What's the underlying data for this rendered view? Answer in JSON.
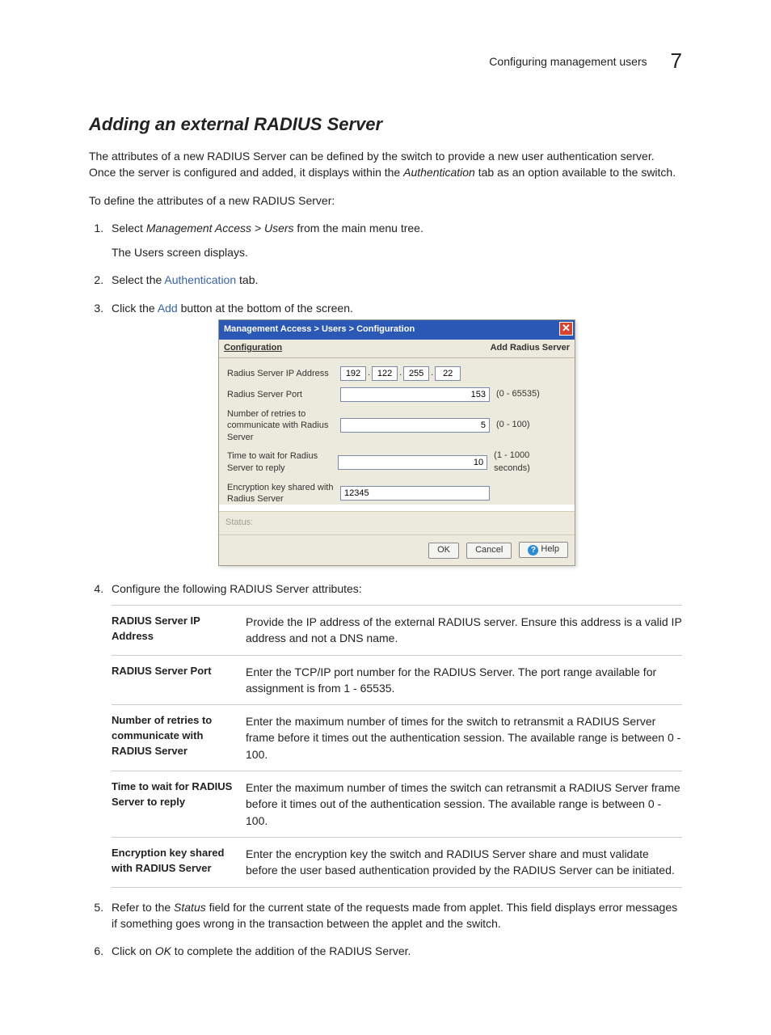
{
  "header": {
    "running_title": "Configuring management users",
    "chapter_number": "7"
  },
  "section_title": "Adding an external RADIUS Server",
  "intro_p1_a": "The attributes of a new RADIUS Server can be defined by the switch to provide a new user authentication server. Once the server is configured and added, it displays within the ",
  "intro_p1_i": "Authentication",
  "intro_p1_b": " tab as an option available to the switch.",
  "intro_p2": "To define the attributes of a new RADIUS Server:",
  "steps": {
    "s1_a": "Select ",
    "s1_i": "Management Access > Users",
    "s1_b": " from the main menu tree.",
    "s1_sub": "The Users screen displays.",
    "s2_a": "Select the ",
    "s2_link": "Authentication",
    "s2_b": " tab.",
    "s3_a": "Click the ",
    "s3_link": "Add",
    "s3_b": " button at the bottom of the screen.",
    "s4": "Configure the following RADIUS Server attributes:",
    "s5_a": "Refer to the ",
    "s5_i": "Status",
    "s5_b": " field for the current state of the requests made from applet. This field displays error messages if something goes wrong in the transaction between the applet and the switch.",
    "s6_a": "Click on ",
    "s6_i": "OK",
    "s6_b": " to complete the addition of the RADIUS Server."
  },
  "dialog": {
    "title": "Management Access > Users > Configuration",
    "close_glyph": "✕",
    "sub_left": "Configuration",
    "sub_right": "Add Radius Server",
    "rows": {
      "ip_label": "Radius Server IP Address",
      "ip": {
        "o1": "192",
        "o2": "122",
        "o3": "255",
        "o4": "22",
        "dot": "."
      },
      "port_label": "Radius Server Port",
      "port_value": "153",
      "port_hint": "(0 - 65535)",
      "retries_label": "Number of retries to communicate with Radius Server",
      "retries_value": "5",
      "retries_hint": "(0 - 100)",
      "wait_label": "Time to wait for Radius Server to reply",
      "wait_value": "10",
      "wait_hint": "(1 - 1000 seconds)",
      "key_label": "Encryption key shared with Radius Server",
      "key_value": "12345"
    },
    "status_label": "Status:",
    "buttons": {
      "ok": "OK",
      "cancel": "Cancel",
      "help": "Help",
      "help_glyph": "?"
    }
  },
  "attributes": [
    {
      "name": "RADIUS Server IP Address",
      "desc": "Provide the IP address of the external RADIUS server. Ensure this address is a valid IP address and not a DNS name."
    },
    {
      "name": "RADIUS Server Port",
      "desc": "Enter the TCP/IP port number for the RADIUS Server. The port range available for assignment is from 1 - 65535."
    },
    {
      "name": "Number of retries to communicate with RADIUS Server",
      "desc": "Enter the maximum number of times for the switch to retransmit a RADIUS Server frame before it times out the authentication session. The available range is between 0 - 100."
    },
    {
      "name": "Time to wait for RADIUS Server to reply",
      "desc": "Enter the maximum number of times the switch can retransmit a RADIUS Server frame before it times out of the authentication session. The available range is between 0 - 100."
    },
    {
      "name": "Encryption key shared with RADIUS Server",
      "desc": "Enter the encryption key the switch and RADIUS Server share and must validate before the user based authentication provided by the RADIUS Server can be initiated."
    }
  ]
}
